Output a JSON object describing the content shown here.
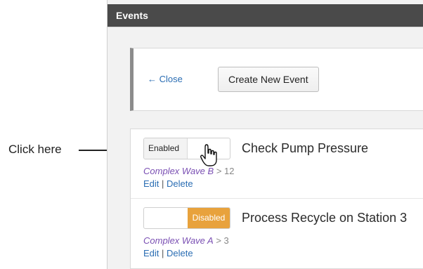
{
  "annotation": {
    "label": "Click here"
  },
  "window": {
    "title": "Events"
  },
  "toolbar": {
    "close_label": "← Close",
    "create_label": "Create New Event"
  },
  "events": [
    {
      "toggle_label": "Enabled",
      "state": "enabled",
      "title": "Check Pump Pressure",
      "wave": "Complex Wave B",
      "sep": ">",
      "value": "12",
      "edit": "Edit",
      "delete": "Delete",
      "bar": "|"
    },
    {
      "toggle_label": "Disabled",
      "state": "disabled",
      "title": "Process Recycle on Station 3",
      "wave": "Complex Wave A",
      "sep": ">",
      "value": "3",
      "edit": "Edit",
      "delete": "Delete",
      "bar": "|"
    }
  ],
  "colors": {
    "titlebar": "#4a4a4a",
    "link": "#2a6db3",
    "wave": "#7a4fb3",
    "disabled": "#e8a23c"
  }
}
